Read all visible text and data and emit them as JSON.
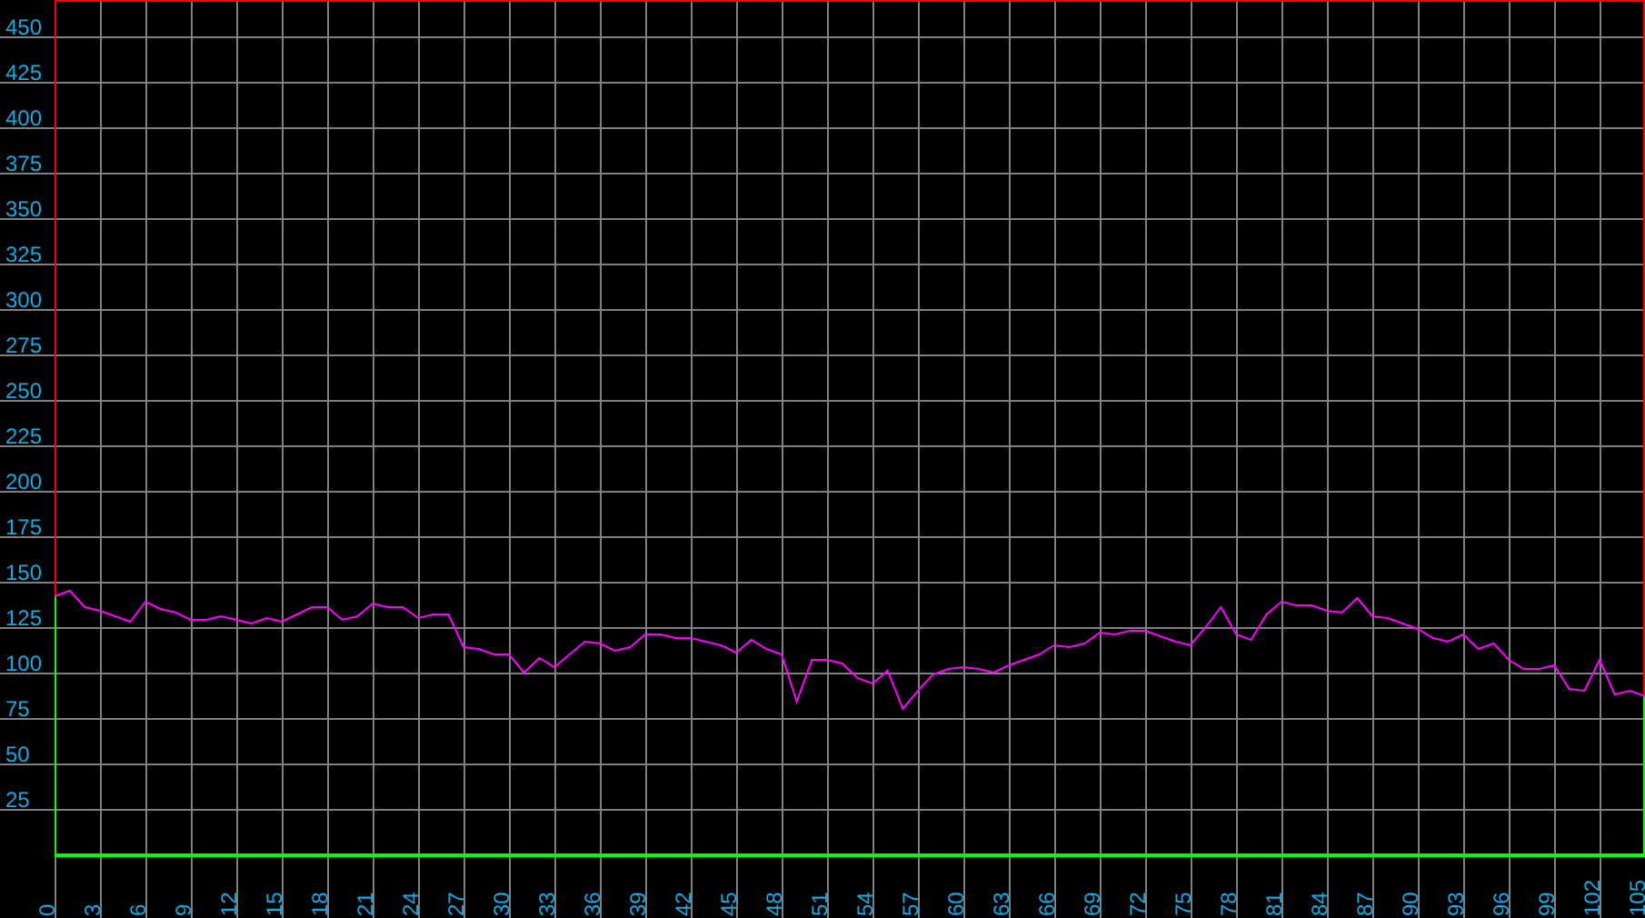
{
  "chart": {
    "chart_data": {
      "type": "line",
      "grid": true,
      "xlim": [
        0,
        105
      ],
      "ylim": [
        0,
        470
      ],
      "x": [
        0,
        1,
        2,
        3,
        4,
        5,
        6,
        7,
        8,
        9,
        10,
        11,
        12,
        13,
        14,
        15,
        16,
        17,
        18,
        19,
        20,
        21,
        22,
        23,
        24,
        25,
        26,
        27,
        28,
        29,
        30,
        31,
        32,
        33,
        34,
        35,
        36,
        37,
        38,
        39,
        40,
        41,
        42,
        43,
        44,
        45,
        46,
        47,
        48,
        49,
        50,
        51,
        52,
        53,
        54,
        55,
        56,
        57,
        58,
        59,
        60,
        61,
        62,
        63,
        64,
        65,
        66,
        67,
        68,
        69,
        70,
        71,
        72,
        73,
        74,
        75,
        76,
        77,
        78,
        79,
        80,
        81,
        82,
        83,
        84,
        85,
        86,
        87,
        88,
        89,
        90,
        91,
        92,
        93,
        94,
        95,
        96,
        97,
        98,
        99,
        100,
        101,
        102,
        103,
        104,
        105
      ],
      "xticks": [
        0,
        3,
        6,
        9,
        12,
        15,
        18,
        21,
        24,
        27,
        30,
        33,
        36,
        39,
        42,
        45,
        48,
        51,
        54,
        57,
        60,
        63,
        66,
        69,
        72,
        75,
        78,
        81,
        84,
        87,
        90,
        93,
        96,
        99,
        102,
        105
      ],
      "yticks": [
        25,
        50,
        75,
        100,
        125,
        150,
        175,
        200,
        225,
        250,
        275,
        300,
        325,
        350,
        375,
        400,
        425,
        450
      ],
      "series": [
        {
          "color": "#ff00ff",
          "values": [
            142,
            145,
            136,
            134,
            131,
            128,
            139,
            135,
            133,
            129,
            129,
            131,
            129,
            127,
            130,
            128,
            132,
            136,
            136,
            129,
            131,
            138,
            136,
            136,
            130,
            132,
            132,
            114,
            113,
            110,
            110,
            100,
            108,
            103,
            110,
            117,
            116,
            112,
            114,
            121,
            121,
            119,
            119,
            117,
            115,
            111,
            118,
            113,
            110,
            84,
            107,
            107,
            105,
            97,
            94,
            101,
            80,
            90,
            99,
            102,
            103,
            102,
            100,
            104,
            107,
            110,
            115,
            114,
            116,
            122,
            121,
            123,
            123,
            120,
            117,
            115,
            125,
            136,
            121,
            118,
            132,
            139,
            137,
            137,
            134,
            133,
            141,
            131,
            130,
            127,
            124,
            119,
            117,
            121,
            113,
            116,
            107,
            102,
            102,
            104,
            91,
            90,
            107,
            88,
            90,
            87
          ]
        }
      ]
    }
  }
}
